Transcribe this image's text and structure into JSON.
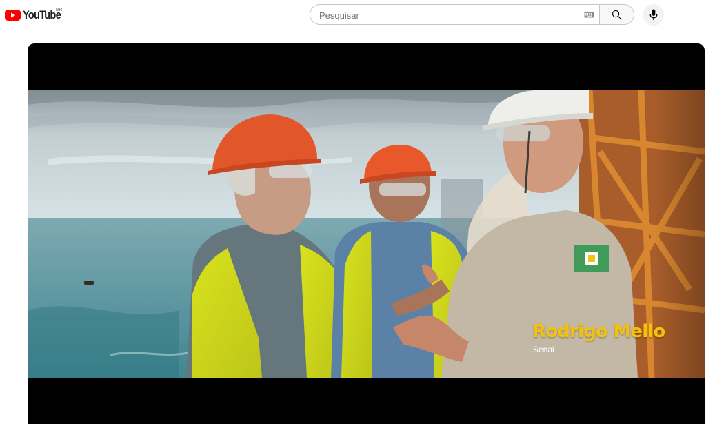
{
  "masthead": {
    "logo_text": "YouTube",
    "country_code": "BR",
    "brand_color": "#ff0000",
    "search": {
      "placeholder": "Pesquisar",
      "value": "",
      "keyboard_icon": "keyboard-icon",
      "search_icon": "search-icon"
    },
    "voice_icon": "microphone-icon"
  },
  "player": {
    "background": "#000000",
    "overlay": {
      "name": "Rodrigo Mello",
      "organization": "Senai",
      "name_color": "#f4c20d"
    }
  }
}
